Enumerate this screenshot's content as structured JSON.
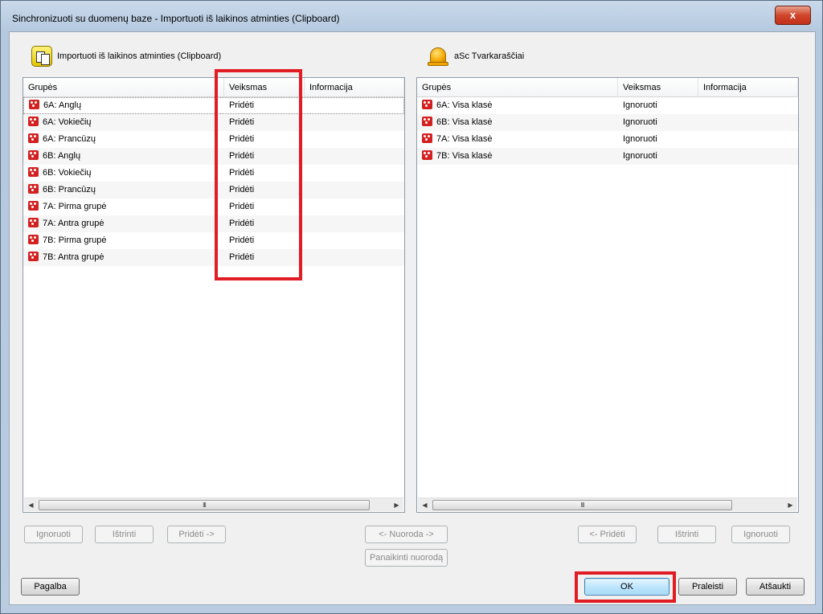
{
  "window": {
    "title": "Sinchronizuoti su duomenų baze - Importuoti iš laikinos atminties (Clipboard)",
    "close_glyph": "x"
  },
  "left": {
    "source_label": "Importuoti iš laikinos atminties (Clipboard)",
    "icon": "clipboard-icon",
    "columns": [
      "Grupės",
      "Veiksmas",
      "Informacija"
    ],
    "rows": [
      {
        "group": "6A: Anglų",
        "action": "Pridėti",
        "info": ""
      },
      {
        "group": "6A: Vokiečių",
        "action": "Pridėti",
        "info": ""
      },
      {
        "group": "6A: Prancūzų",
        "action": "Pridėti",
        "info": ""
      },
      {
        "group": "6B: Anglų",
        "action": "Pridėti",
        "info": ""
      },
      {
        "group": "6B: Vokiečių",
        "action": "Pridėti",
        "info": ""
      },
      {
        "group": "6B: Prancūzų",
        "action": "Pridėti",
        "info": ""
      },
      {
        "group": "7A: Pirma grupė",
        "action": "Pridėti",
        "info": ""
      },
      {
        "group": "7A: Antra grupė",
        "action": "Pridėti",
        "info": ""
      },
      {
        "group": "7B: Pirma grupė",
        "action": "Pridėti",
        "info": ""
      },
      {
        "group": "7B: Antra grupė",
        "action": "Pridėti",
        "info": ""
      }
    ],
    "scroll_thumb_grip": "III"
  },
  "right": {
    "source_label": "aSc Tvarkaraščiai",
    "icon": "bell-icon",
    "columns": [
      "Grupės",
      "Veiksmas",
      "Informacija"
    ],
    "rows": [
      {
        "group": "6A: Visa klasė",
        "action": "Ignoruoti",
        "info": ""
      },
      {
        "group": "6B: Visa klasė",
        "action": "Ignoruoti",
        "info": ""
      },
      {
        "group": "7A: Visa klasė",
        "action": "Ignoruoti",
        "info": ""
      },
      {
        "group": "7B: Visa klasė",
        "action": "Ignoruoti",
        "info": ""
      }
    ],
    "scroll_thumb_grip": "III"
  },
  "actions": {
    "left_ignore": "Ignoruoti",
    "left_delete": "Ištrinti",
    "left_add": "Pridėti ->",
    "link": "<- Nuoroda ->",
    "unlink": "Panaikinti nuorodą",
    "right_add": "<- Pridėti",
    "right_delete": "Ištrinti",
    "right_ignore": "Ignoruoti"
  },
  "footer": {
    "help": "Pagalba",
    "ok": "OK",
    "skip": "Praleisti",
    "cancel": "Atšaukti"
  },
  "colors": {
    "highlight": "#e01c24",
    "group_icon": "#d32020"
  }
}
